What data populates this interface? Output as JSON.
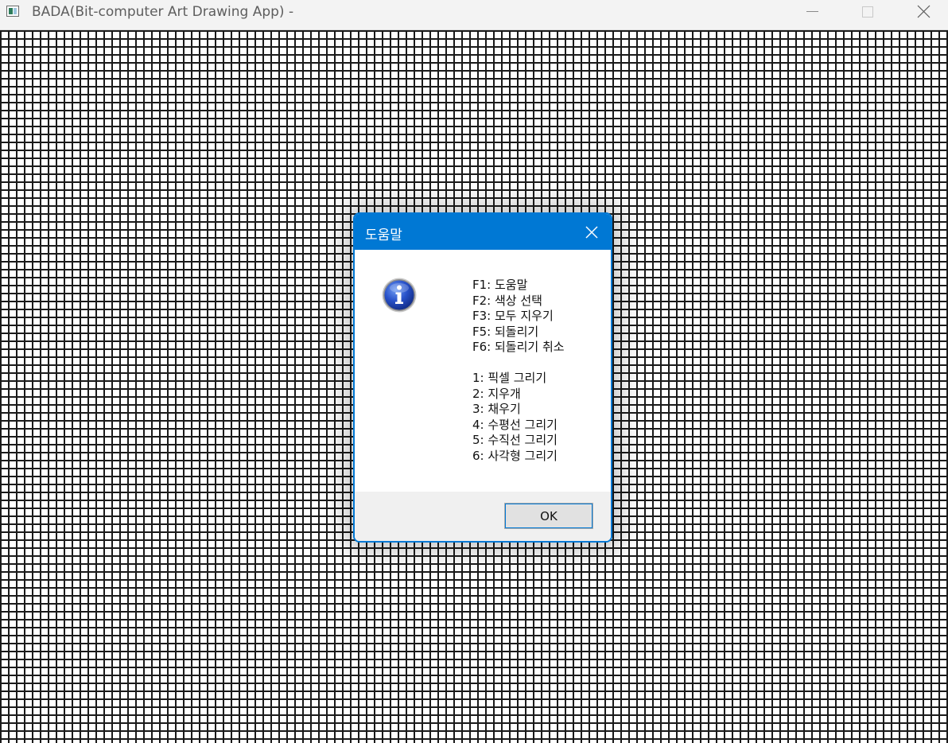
{
  "window": {
    "title": "BADA(Bit-computer Art Drawing App) -"
  },
  "dialog": {
    "title": "도움말",
    "function_keys": [
      "F1: 도움말",
      "F2: 색상 선택",
      "F3: 모두 지우기",
      "F5: 되돌리기",
      "F6: 되돌리기 취소"
    ],
    "tools": [
      "1: 픽셀 그리기",
      "2: 지우개",
      "3: 채우기",
      "4: 수평선 그리기",
      "5: 수직선 그리기",
      "6: 사각형 그리기"
    ],
    "ok_label": "OK",
    "icon": "info-icon"
  },
  "colors": {
    "accent": "#0078d4",
    "grid_line": "#1a1a1a"
  }
}
